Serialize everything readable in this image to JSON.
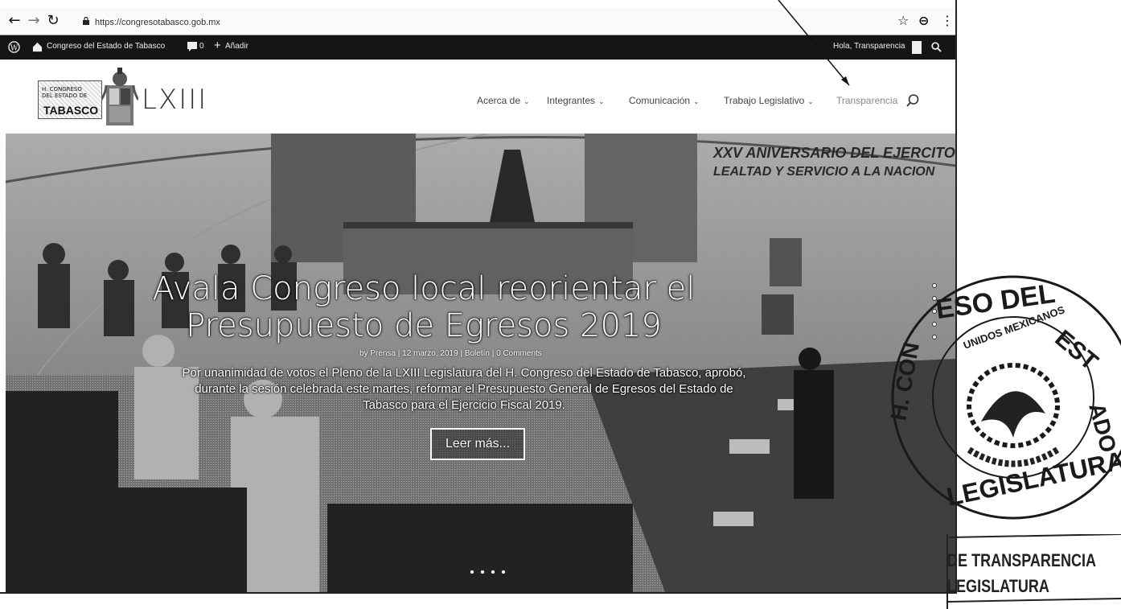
{
  "browser": {
    "url": "https://congresotabasco.gob.mx"
  },
  "admin_bar": {
    "site_name": "Congreso del Estado de Tabasco",
    "comments_count": "0",
    "new_label": "Añadir",
    "greeting": "Hola, Transparencia"
  },
  "logo": {
    "line1": "H. CONGRESO",
    "line2": "DEL ESTADO DE",
    "line3": "TABASCO",
    "legislature": "LXIII"
  },
  "nav": {
    "items": [
      {
        "label": "Acerca de",
        "has_dropdown": true
      },
      {
        "label": "Integrantes",
        "has_dropdown": true
      },
      {
        "label": "Comunicación",
        "has_dropdown": true
      },
      {
        "label": "Trabajo Legislativo",
        "has_dropdown": true
      },
      {
        "label": "Transparencia",
        "has_dropdown": false
      }
    ]
  },
  "hero": {
    "banner_text_1": "XXV ANIVERSARIO DEL EJERCITO MEX.",
    "banner_text_2": "LEALTAD Y SERVICIO A LA NACION",
    "title_line1": "Avala Congreso local reorientar el",
    "title_line2": "Presupuesto de Egresos 2019",
    "meta": "by Prensa | 12 marzo, 2019 | Boletín | 0 Comments",
    "excerpt_line1": "Por unanimidad de votos el Pleno de la LXIII Legislatura del H. Congreso del Estado de Tabasco, aprobó,",
    "excerpt_line2": "durante la sesión celebrada este martes, reformar el Presupuesto General de Egresos del Estado de",
    "excerpt_line3": "Tabasco para el Ejercicio Fiscal 2019.",
    "read_more": "Leer más..."
  },
  "stamps": {
    "seal_outer": "H. CONGRESO DEL ESTADO",
    "seal_inner": "ESTADOS UNIDOS MEXICANOS",
    "seal_bottom": "LXIII LEGISLATURA",
    "transparency_line1": "DE TRANSPARENCIA",
    "transparency_line2": "LEGISLATURA"
  },
  "colors": {
    "admin_bar_bg": "#151515",
    "nav_text": "#444444",
    "hero_text": "#ffffff"
  },
  "icons": {
    "back": "arrow-left-icon",
    "forward": "arrow-right-icon",
    "reload": "reload-icon",
    "lock": "lock-icon",
    "bookmark": "star-icon",
    "profile": "profile-icon",
    "menu": "kebab-menu-icon",
    "wordpress": "wordpress-icon",
    "home": "home-icon",
    "comment": "comment-icon",
    "add": "plus-icon",
    "search": "search-icon"
  }
}
